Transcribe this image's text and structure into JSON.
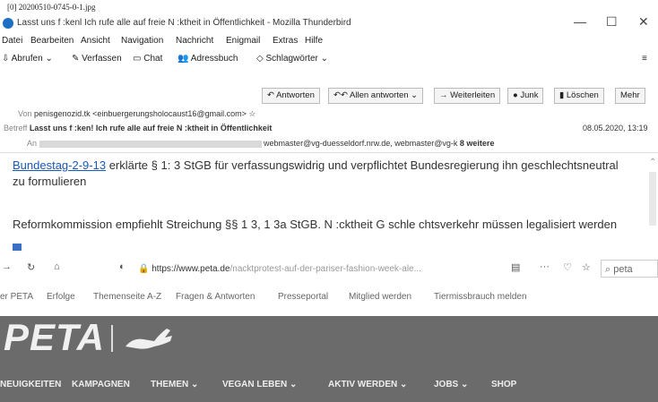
{
  "filename": "[0] 20200510-0745-0-1.jpg",
  "window": {
    "title": "Lasst uns f :kenl Ich rufe alle auf freie N :ktheit in Öffentlichkeit - Mozilla Thunderbird",
    "minimize": "—",
    "maximize": "☐",
    "close": "✕"
  },
  "menu": [
    "Datei",
    "Bearbeiten",
    "Ansicht",
    "Navigation",
    "Nachricht",
    "Enigmail",
    "Extras",
    "Hilfe"
  ],
  "toolbar": {
    "get": "Abrufen",
    "compose": "Verfassen",
    "chat": "Chat",
    "addressbook": "Adressbuch",
    "tags": "Schlagwörter",
    "menu": "≡"
  },
  "message_actions": {
    "reply": "Antworten",
    "reply_all": "Allen antworten",
    "forward": "Weiterleiten",
    "junk": "Junk",
    "delete": "Löschen",
    "more": "Mehr"
  },
  "header": {
    "from_label": "Von",
    "from_value": "penisgenozid.tk <einbuergerungsholocaust16@gmail.com>",
    "subject_label": "Betreff",
    "subject_value": "Lasst uns f :ken! Ich rufe alle auf freie N :ktheit in Öffentlichkeit",
    "date": "08.05.2020, 13:19",
    "to_label": "An",
    "to_value": "webmaster@vg-duesseldorf.nrw.de, webmaster@vg-k",
    "to_more": "8 weitere"
  },
  "body": {
    "link": "Bundestag-2-9-13",
    "line1": " erklärte § 1: 3 StGB für verfassungswidrig und verpflichtet Bundesregierung ihn geschlechtsneutral",
    "line2": "zu formulieren",
    "line3": "Reformkommission empfiehlt Streichung §§ 1 3, 1 3a StGB. N :cktheit G schle chtsverkehr müssen legalisiert werden"
  },
  "browser": {
    "url_domain": "https://www.peta.de",
    "url_path": "/nacktprotest-auf-der-pariser-fashion-week-ale...",
    "search": "peta"
  },
  "peta_nav": [
    "er PETA",
    "Erfolge",
    "Themenseite A-Z",
    "Fragen & Antworten",
    "Presseportal",
    "Mitglied werden",
    "Tiermissbrauch melden"
  ],
  "peta_logo": "PETA",
  "peta_menu": [
    "NEUIGKEITEN",
    "KAMPAGNEN",
    "THEMEN ⌄",
    "VEGAN LEBEN ⌄",
    "AKTIV WERDEN ⌄",
    "JOBS ⌄",
    "SHOP"
  ]
}
